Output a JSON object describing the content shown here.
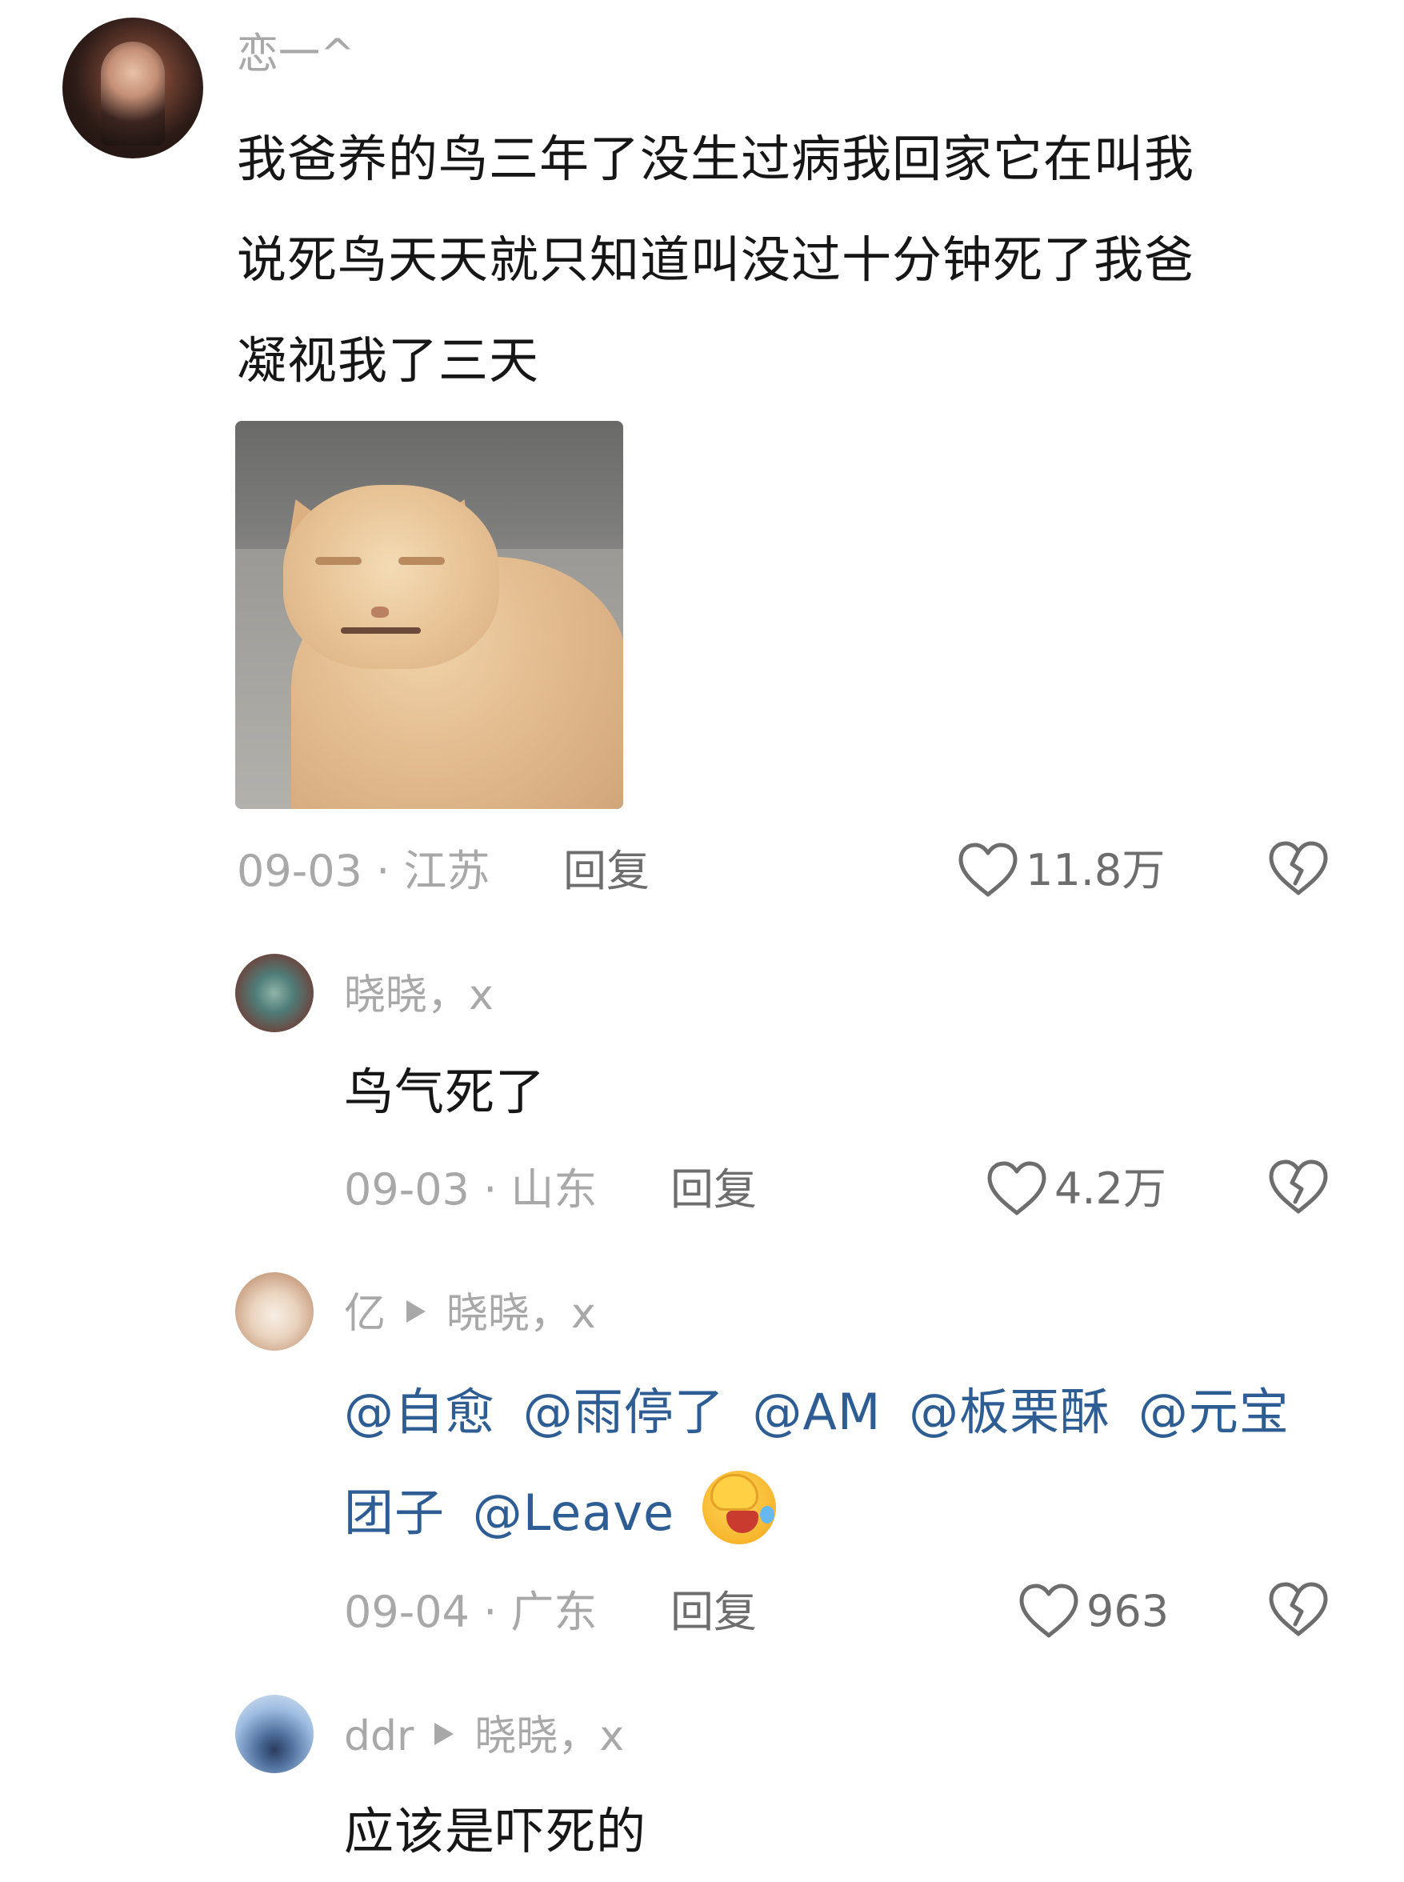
{
  "main_comment": {
    "username": "恋一^",
    "text_lines": [
      "我爸养的鸟三年了没生过病我回家它在叫我",
      "说死鸟天天就只知道叫没过十分钟死了我爸",
      "凝视我了三天"
    ],
    "date_location": "09-03 · 江苏",
    "reply_label": "回复",
    "likes": "11.8万",
    "image": "cat-photo"
  },
  "replies": [
    {
      "username": "晓晓，x",
      "reply_to": "",
      "text": "鸟气死了",
      "date_location": "09-03 · 山东",
      "reply_label": "回复",
      "likes": "4.2万"
    },
    {
      "username": "亿",
      "reply_to": "晓晓，x",
      "mentions": [
        "@自愈",
        "@雨停了",
        "@AM",
        "@板栗酥",
        "@元宝",
        "团子",
        "@Leave"
      ],
      "emoji": "laughing-emoji",
      "date_location": "09-04 · 广东",
      "reply_label": "回复",
      "likes": "963"
    },
    {
      "username": "ddr",
      "reply_to": "晓晓，x",
      "text": "应该是吓死的"
    }
  ],
  "colors": {
    "mention": "#2d5d93",
    "secondary_text": "#a8a8a8",
    "icon": "#6d6d6d"
  }
}
